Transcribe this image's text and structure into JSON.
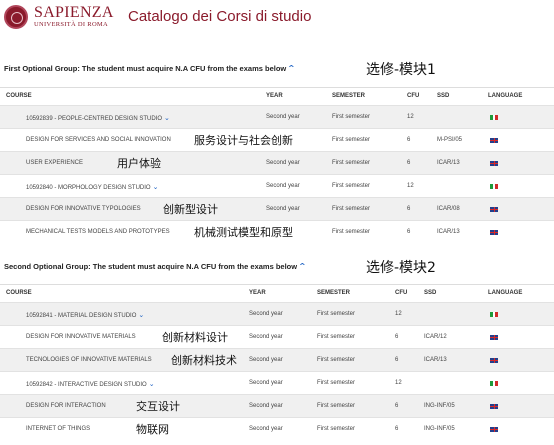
{
  "header": {
    "brand_name": "SAPIENZA",
    "brand_sub": "UNIVERSITÀ DI ROMA",
    "title": "Catalogo dei Corsi di studio"
  },
  "groups": [
    {
      "title": "First Optional Group: The student must acquire N.A CFU from the exams below",
      "annotation": "选修-模块1",
      "columns": [
        "COURSE",
        "YEAR",
        "SEMESTER",
        "CFU",
        "SSD",
        "LANGUAGE"
      ],
      "rows": [
        {
          "course": "10592839 - PEOPLE-CENTRED DESIGN STUDIO",
          "year": "Second year",
          "semester": "First semester",
          "cfu": "12",
          "ssd": "",
          "language": "it",
          "expand": true,
          "note": ""
        },
        {
          "course": "DESIGN FOR SERVICES AND SOCIAL INNOVATION",
          "year": "",
          "semester": "First semester",
          "cfu": "6",
          "ssd": "M-PSI/05",
          "language": "uk",
          "expand": false,
          "note": "服务设计与社会创新"
        },
        {
          "course": "USER EXPERIENCE",
          "year": "Second year",
          "semester": "First semester",
          "cfu": "6",
          "ssd": "ICAR/13",
          "language": "uk",
          "expand": false,
          "note": "用户体验"
        },
        {
          "course": "10592840 - MORPHOLOGY DESIGN STUDIO",
          "year": "Second year",
          "semester": "First semester",
          "cfu": "12",
          "ssd": "",
          "language": "it",
          "expand": true,
          "note": ""
        },
        {
          "course": "DESIGN FOR INNOVATIVE TYPOLOGIES",
          "year": "Second year",
          "semester": "First semester",
          "cfu": "6",
          "ssd": "ICAR/08",
          "language": "uk",
          "expand": false,
          "note": "创新型设计"
        },
        {
          "course": "MECHANICAL TESTS MODELS AND PROTOTYPES",
          "year": "",
          "semester": "First semester",
          "cfu": "6",
          "ssd": "ICAR/13",
          "language": "uk",
          "expand": false,
          "note": "机械测试模型和原型"
        }
      ]
    },
    {
      "title": "Second Optional Group: The student must acquire N.A CFU from the exams below",
      "annotation": "选修-模块2",
      "columns": [
        "COURSE",
        "YEAR",
        "SEMESTER",
        "CFU",
        "SSD",
        "LANGUAGE"
      ],
      "rows": [
        {
          "course": "10592841 - MATERIAL DESIGN STUDIO",
          "year": "Second year",
          "semester": "First semester",
          "cfu": "12",
          "ssd": "",
          "language": "it",
          "expand": true,
          "note": ""
        },
        {
          "course": "DESIGN FOR INNOVATIVE MATERIALS",
          "year": "Second year",
          "semester": "First semester",
          "cfu": "6",
          "ssd": "ICAR/12",
          "language": "uk",
          "expand": false,
          "note": "创新材料设计"
        },
        {
          "course": "TECNOLOGIES OF INNOVATIVE MATERIALS",
          "year": "Second year",
          "semester": "First semester",
          "cfu": "6",
          "ssd": "ICAR/13",
          "language": "uk",
          "expand": false,
          "note": "创新材料技术"
        },
        {
          "course": "10592842 - INTERACTIVE DESIGN STUDIO",
          "year": "Second year",
          "semester": "First semester",
          "cfu": "12",
          "ssd": "",
          "language": "it",
          "expand": true,
          "note": ""
        },
        {
          "course": "DESIGN FOR INTERACTION",
          "year": "Second year",
          "semester": "First semester",
          "cfu": "6",
          "ssd": "ING-INF/05",
          "language": "uk",
          "expand": false,
          "note": "交互设计"
        },
        {
          "course": "INTERNET OF THINGS",
          "year": "Second year",
          "semester": "First semester",
          "cfu": "6",
          "ssd": "ING-INF/05",
          "language": "uk",
          "expand": false,
          "note": "物联网"
        }
      ]
    }
  ],
  "colors": {
    "brand": "#8a1a2b",
    "link": "#1f63c4",
    "row_shade": "#f0f0f0"
  }
}
